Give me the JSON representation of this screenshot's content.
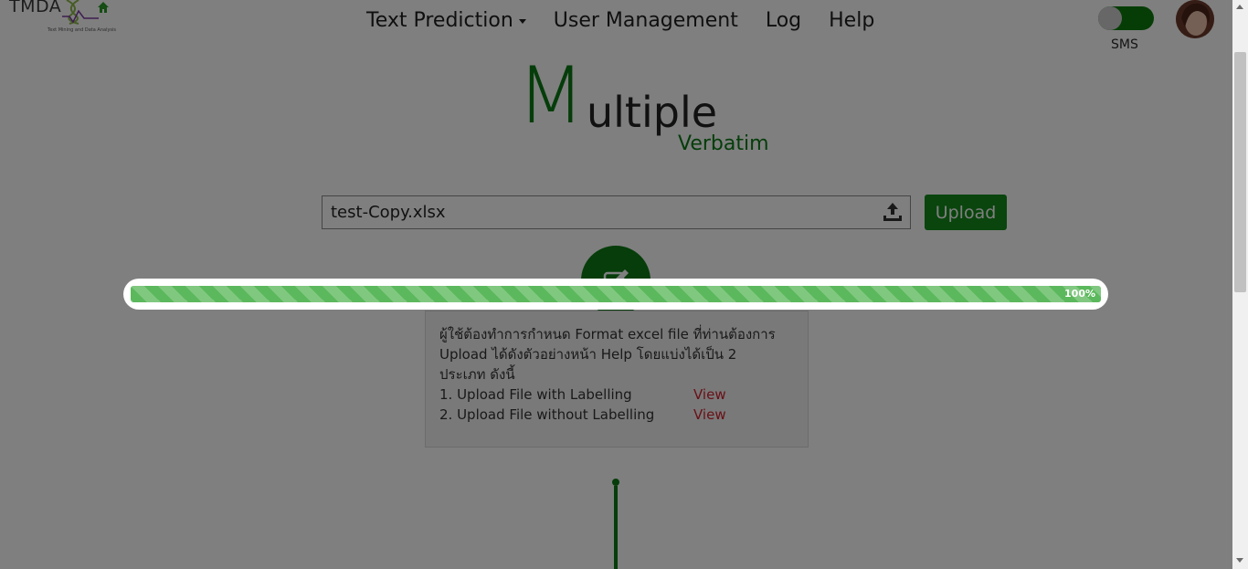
{
  "logo": {
    "text": "TMDA",
    "subtitle": "Text Mining and Data Analysis"
  },
  "nav": {
    "items": [
      {
        "label": "Text Prediction",
        "has_caret": true
      },
      {
        "label": "User Management"
      },
      {
        "label": "Log"
      },
      {
        "label": "Help"
      }
    ]
  },
  "sms": {
    "label": "SMS",
    "enabled": true
  },
  "title": {
    "initial": "M",
    "rest": "ultiple",
    "subtitle": "Verbatim"
  },
  "upload": {
    "file_name": "test-Copy.xlsx",
    "button_label": "Upload"
  },
  "info": {
    "description": "ผู้ใช้ต้องทำการกำหนด Format excel file ที่ท่านต้องการ Upload ได้ดังตัวอย่างหน้า Help โดยแบ่งได้เป็น 2 ประเภท ดังนี้",
    "items": [
      {
        "label": "1. Upload File with Labelling",
        "link": "View"
      },
      {
        "label": "2. Upload File without Labelling",
        "link": "View"
      }
    ]
  },
  "progress": {
    "value": 1.0,
    "label": "100%"
  },
  "colors": {
    "accent": "#128a1a",
    "link": "#d2202f"
  }
}
